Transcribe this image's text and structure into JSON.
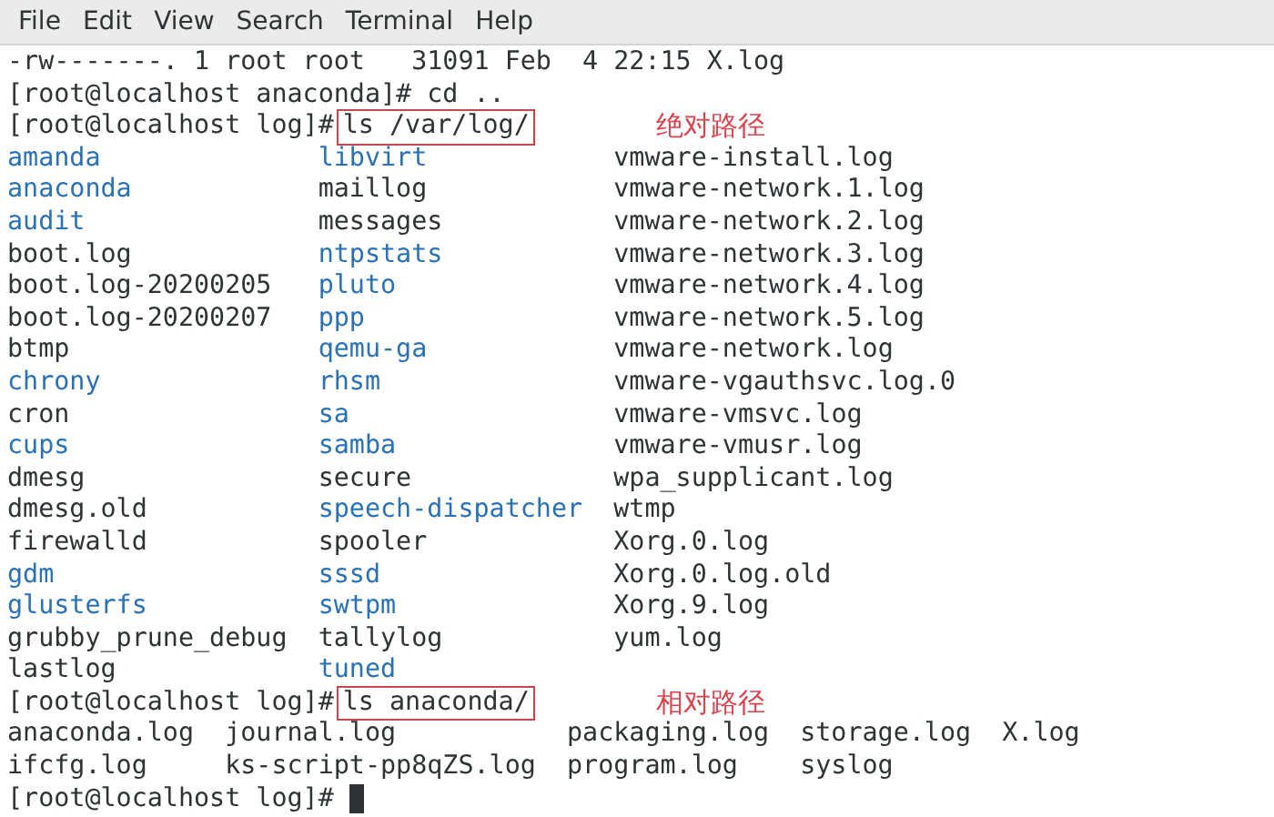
{
  "menu": [
    "File",
    "Edit",
    "View",
    "Search",
    "Terminal",
    "Help"
  ],
  "lines": [
    {
      "kind": "text",
      "text": "-rw-------. 1 root root   31091 Feb  4 22:15 X.log"
    },
    {
      "kind": "prompt",
      "prompt": "[root@localhost anaconda]#",
      "command": "cd ..",
      "boxed": false
    },
    {
      "kind": "prompt",
      "prompt": "[root@localhost log]#",
      "command": "ls /var/log/",
      "boxed": true,
      "note": "绝对路径"
    },
    {
      "kind": "listing",
      "rows": [
        [
          {
            "name": "amanda",
            "dir": true
          },
          {
            "name": "libvirt",
            "dir": true
          },
          {
            "name": "vmware-install.log",
            "dir": false
          }
        ],
        [
          {
            "name": "anaconda",
            "dir": true
          },
          {
            "name": "maillog",
            "dir": false
          },
          {
            "name": "vmware-network.1.log",
            "dir": false
          }
        ],
        [
          {
            "name": "audit",
            "dir": true
          },
          {
            "name": "messages",
            "dir": false
          },
          {
            "name": "vmware-network.2.log",
            "dir": false
          }
        ],
        [
          {
            "name": "boot.log",
            "dir": false
          },
          {
            "name": "ntpstats",
            "dir": true
          },
          {
            "name": "vmware-network.3.log",
            "dir": false
          }
        ],
        [
          {
            "name": "boot.log-20200205",
            "dir": false
          },
          {
            "name": "pluto",
            "dir": true
          },
          {
            "name": "vmware-network.4.log",
            "dir": false
          }
        ],
        [
          {
            "name": "boot.log-20200207",
            "dir": false
          },
          {
            "name": "ppp",
            "dir": true
          },
          {
            "name": "vmware-network.5.log",
            "dir": false
          }
        ],
        [
          {
            "name": "btmp",
            "dir": false
          },
          {
            "name": "qemu-ga",
            "dir": true
          },
          {
            "name": "vmware-network.log",
            "dir": false
          }
        ],
        [
          {
            "name": "chrony",
            "dir": true
          },
          {
            "name": "rhsm",
            "dir": true
          },
          {
            "name": "vmware-vgauthsvc.log.0",
            "dir": false
          }
        ],
        [
          {
            "name": "cron",
            "dir": false
          },
          {
            "name": "sa",
            "dir": true
          },
          {
            "name": "vmware-vmsvc.log",
            "dir": false
          }
        ],
        [
          {
            "name": "cups",
            "dir": true
          },
          {
            "name": "samba",
            "dir": true
          },
          {
            "name": "vmware-vmusr.log",
            "dir": false
          }
        ],
        [
          {
            "name": "dmesg",
            "dir": false
          },
          {
            "name": "secure",
            "dir": false
          },
          {
            "name": "wpa_supplicant.log",
            "dir": false
          }
        ],
        [
          {
            "name": "dmesg.old",
            "dir": false
          },
          {
            "name": "speech-dispatcher",
            "dir": true
          },
          {
            "name": "wtmp",
            "dir": false
          }
        ],
        [
          {
            "name": "firewalld",
            "dir": false
          },
          {
            "name": "spooler",
            "dir": false
          },
          {
            "name": "Xorg.0.log",
            "dir": false
          }
        ],
        [
          {
            "name": "gdm",
            "dir": true
          },
          {
            "name": "sssd",
            "dir": true
          },
          {
            "name": "Xorg.0.log.old",
            "dir": false
          }
        ],
        [
          {
            "name": "glusterfs",
            "dir": true
          },
          {
            "name": "swtpm",
            "dir": true
          },
          {
            "name": "Xorg.9.log",
            "dir": false
          }
        ],
        [
          {
            "name": "grubby_prune_debug",
            "dir": false
          },
          {
            "name": "tallylog",
            "dir": false
          },
          {
            "name": "yum.log",
            "dir": false
          }
        ],
        [
          {
            "name": "lastlog",
            "dir": false
          },
          {
            "name": "tuned",
            "dir": true
          }
        ]
      ]
    },
    {
      "kind": "prompt",
      "prompt": "[root@localhost log]#",
      "command": "ls anaconda/",
      "boxed": true,
      "note": "相对路径"
    },
    {
      "kind": "listing",
      "rows": [
        [
          {
            "name": "anaconda.log",
            "dir": false
          },
          {
            "name": "journal.log",
            "dir": false
          },
          {
            "name": "packaging.log",
            "dir": false
          },
          {
            "name": "storage.log",
            "dir": false
          },
          {
            "name": "X.log",
            "dir": false
          }
        ],
        [
          {
            "name": "ifcfg.log",
            "dir": false
          },
          {
            "name": "ks-script-pp8qZS.log",
            "dir": false
          },
          {
            "name": "program.log",
            "dir": false
          },
          {
            "name": "syslog",
            "dir": false
          }
        ]
      ]
    },
    {
      "kind": "prompt",
      "prompt": "[root@localhost log]#",
      "cursor": true
    }
  ]
}
